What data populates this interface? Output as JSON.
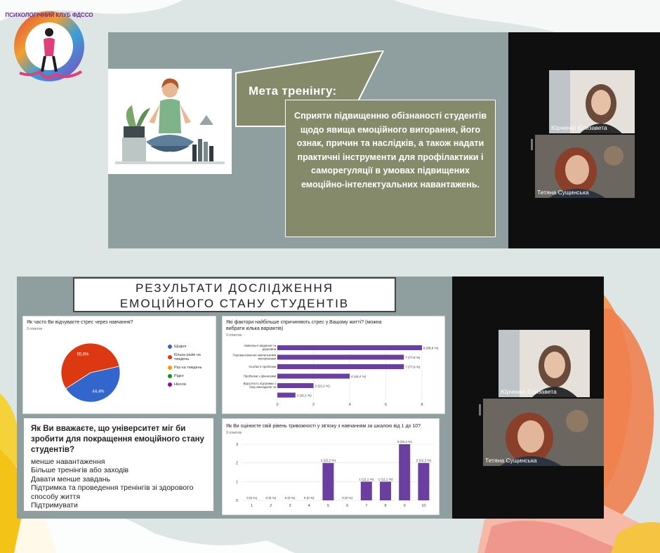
{
  "logo": {
    "text": "ПСИХОЛОГІЧНИЙ КЛУБ ФДССО"
  },
  "slide1": {
    "goal_title": "Мета тренінгу:",
    "goal_text": "Сприяти підвищенню обізнаності студентів щодо явища емоційного вигорання, його ознак, причин та наслідків, а також надати практичні інструменти для профілактики і саморегуляції в умовах підвищених емоційно-інтелектуальних навантажень."
  },
  "meeting1": {
    "participants": [
      {
        "name": "Юрченко Єлизавета"
      },
      {
        "name": "Тетяна Сущинська"
      }
    ]
  },
  "slide2": {
    "title_line1": "РЕЗУЛЬТАТИ ДОСЛІДЖЕННЯ",
    "title_line2": "ЕМОЦІЙНОГО СТАНУ СТУДЕНТІВ"
  },
  "pie_card": {
    "question": "Як часто Ви відчуваєте стрес через навчання?",
    "responses": "9 ответов"
  },
  "bar_card": {
    "question": "Які фактори найбільше спричиняють стрес у Вашому житті? (можна вибрати кілька варіантів)",
    "responses": "9 ответов"
  },
  "col_card": {
    "question": "Як Ви оцінюєте свій рівень тривожності у зв'язку з навчанням за шкалою від 1 до 10?",
    "responses": "9 ответов"
  },
  "open_question": {
    "question": "Як Ви вважаєте, що університет міг би зробити для покращення емоційного стану студентів?",
    "answers": [
      "менше навантаження",
      "Більше тренінгів або заходів",
      "Давати менше завдань",
      "Підтримка та проведення тренінгів зі здорового способу життя",
      "Підтримувати"
    ]
  },
  "meeting2": {
    "participants": [
      {
        "name": "Юрченко Єлизавета"
      },
      {
        "name": "Тетяна Сущинська"
      }
    ]
  },
  "colors": {
    "slide_bg": "#8f9fa0",
    "goal_fill": "#858a6a",
    "bar_purple": "#6b3fa0",
    "pie_orange": "#dc3912",
    "pie_blue": "#3366cc"
  },
  "chart_data": [
    {
      "type": "pie",
      "title": "Як часто Ви відчуваєте стрес через навчання?",
      "legend": [
        "Щодня",
        "Кілька разів на тиждень",
        "Раз на тиждень",
        "Рідко",
        "Ніколи"
      ],
      "legend_colors": [
        "#3366cc",
        "#dc3912",
        "#ff9900",
        "#109618",
        "#990099"
      ],
      "values": [
        44.4,
        55.6,
        0,
        0,
        0
      ],
      "labels": [
        "44,4%",
        "55,6%"
      ]
    },
    {
      "type": "bar",
      "orientation": "horizontal",
      "title": "Які фактори найбільше спричиняють стрес у Вашому житті? (можна вибрати кілька варіантів)",
      "categories": [
        "Навчальні завдання та дедлайни",
        "Перевантаження навчальними матеріалами",
        "Особисті проблеми",
        "Проблеми з фінансами",
        "Відсутність підтримки з боку викладачів чи одногрупників",
        ""
      ],
      "values": [
        8,
        7,
        7,
        4,
        2,
        1
      ],
      "value_labels": [
        "8 (88,9 %)",
        "7 (77,8 %)",
        "7 (77,8 %)",
        "4 (44,4 %)",
        "2 (22,2 %)",
        "1 (11,1 %)"
      ],
      "xticks": [
        "0",
        "2",
        "4",
        "6",
        "8"
      ],
      "xlim": [
        0,
        8
      ]
    },
    {
      "type": "bar",
      "title": "Як Ви оцінюєте свій рівень тривожності у зв'язку з навчанням за шкалою від 1 до 10?",
      "categories": [
        "1",
        "2",
        "3",
        "4",
        "5",
        "6",
        "7",
        "8",
        "9",
        "10"
      ],
      "values": [
        0,
        0,
        0,
        0,
        2,
        0,
        1,
        1,
        3,
        2
      ],
      "value_labels": [
        "0 (0 %)",
        "0 (0 %)",
        "0 (0 %)",
        "0 (0 %)",
        "2 (22,2 %)",
        "0 (0 %)",
        "1 (11,1 %)",
        "1 (11,1 %)",
        "3 (33,3 %)",
        "2 (22,2 %)"
      ],
      "yticks": [
        "0",
        "1",
        "2",
        "3"
      ],
      "ylim": [
        0,
        3
      ]
    }
  ]
}
